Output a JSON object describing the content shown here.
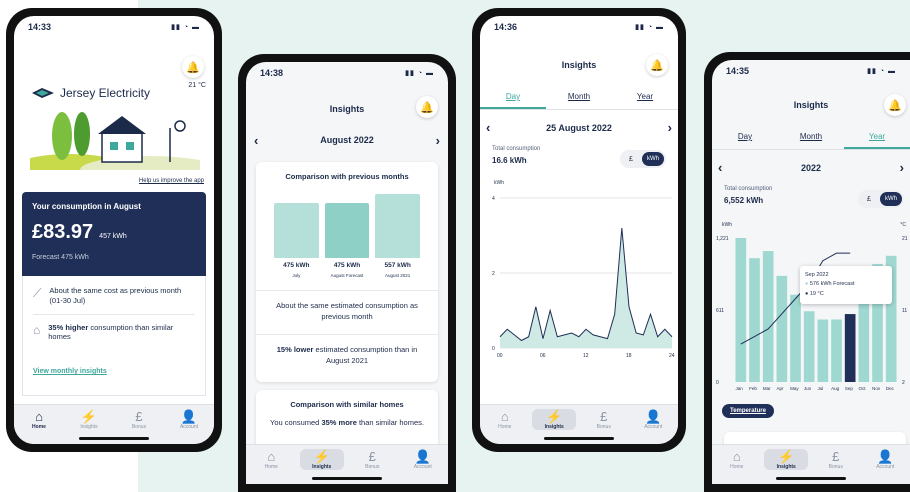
{
  "phone1": {
    "time": "14:33",
    "temperature": "21 °C",
    "brand": "Jersey Electricity",
    "help_link": "Help us improve the app",
    "consumption_title": "Your consumption in August",
    "amount": "£83.97",
    "amount_kwh": "457 kWh",
    "forecast": "Forecast 475 kWh",
    "insight1": "About the same cost as previous month (01-30 Jul)",
    "insight2_bold": "35% higher",
    "insight2_rest": " consumption than similar homes",
    "view_link": "View monthly insights"
  },
  "tabs": [
    "Home",
    "Insights",
    "Bonus",
    "Account"
  ],
  "phone2": {
    "time": "14:38",
    "title": "Insights",
    "month": "August 2022",
    "card1_title": "Comparison with previous months",
    "bars": [
      {
        "value": "475 kWh",
        "label": "July",
        "level": 475
      },
      {
        "value": "475 kWh",
        "label": "August Forecast",
        "level": 475
      },
      {
        "value": "557 kWh",
        "label": "August 2021",
        "level": 557
      }
    ],
    "text1": "About the same estimated consumption as previous month",
    "text2_bold": "15% lower",
    "text2_rest": " estimated consumption than in August 2021",
    "card2_title": "Comparison with similar homes",
    "card2_text_a": "You consumed ",
    "card2_text_bold": "35% more",
    "card2_text_b": " than similar homes."
  },
  "phone3": {
    "time": "14:36",
    "title": "Insights",
    "period_tabs": [
      "Day",
      "Month",
      "Year"
    ],
    "date": "25 August 2022",
    "total_label": "Total consumption",
    "total_value": "16.6 kWh",
    "unit_pound": "£",
    "unit_kwh": "kWh",
    "y_unit": "kWh",
    "chart_data": {
      "type": "area",
      "x": [
        0,
        1,
        2,
        3,
        4,
        5,
        6,
        7,
        8,
        9,
        10,
        11,
        12,
        13,
        14,
        15,
        16,
        17,
        18,
        19,
        20,
        21,
        22,
        23,
        24
      ],
      "values": [
        0.3,
        0.5,
        0.35,
        0.2,
        0.3,
        1.1,
        0.25,
        1.0,
        0.3,
        0.35,
        0.4,
        0.3,
        0.5,
        0.35,
        0.3,
        0.25,
        0.9,
        3.2,
        1.1,
        0.4,
        0.35,
        0.9,
        0.3,
        0.5,
        0.3
      ],
      "xticks": [
        "00",
        "06",
        "12",
        "18",
        "24"
      ],
      "yticks": [
        "0",
        "2",
        "4"
      ],
      "ylim": [
        0,
        4
      ]
    }
  },
  "phone4": {
    "time": "14:35",
    "title": "Insights",
    "period_tabs": [
      "Day",
      "Month",
      "Year"
    ],
    "year": "2022",
    "total_label": "Total consumption",
    "total_value": "6,552 kWh",
    "unit_pound": "£",
    "unit_kwh": "kWh",
    "y_unit_left": "kWh",
    "y_unit_right": "°C",
    "tooltip_title": "Sep 2022",
    "tooltip_line1": "576 kWh Forecast",
    "tooltip_line2": "19 °C",
    "temp_button": "Temperature",
    "chart_data": {
      "type": "bar",
      "categories": [
        "Jan",
        "Feb",
        "Mar",
        "Apr",
        "May",
        "Jun",
        "Jul",
        "Aug",
        "Sep",
        "Oct",
        "Nov",
        "Dec"
      ],
      "values": [
        1221,
        1050,
        1110,
        900,
        740,
        600,
        530,
        530,
        576,
        800,
        1000,
        1070
      ],
      "temperature": [
        7,
        8,
        9,
        11,
        13,
        15,
        18,
        19,
        19,
        null,
        null,
        null
      ],
      "yticks_left": [
        "0",
        "611",
        "1,221"
      ],
      "yticks_right": [
        "2",
        "11",
        "21"
      ],
      "ylim": [
        0,
        1221
      ]
    }
  }
}
